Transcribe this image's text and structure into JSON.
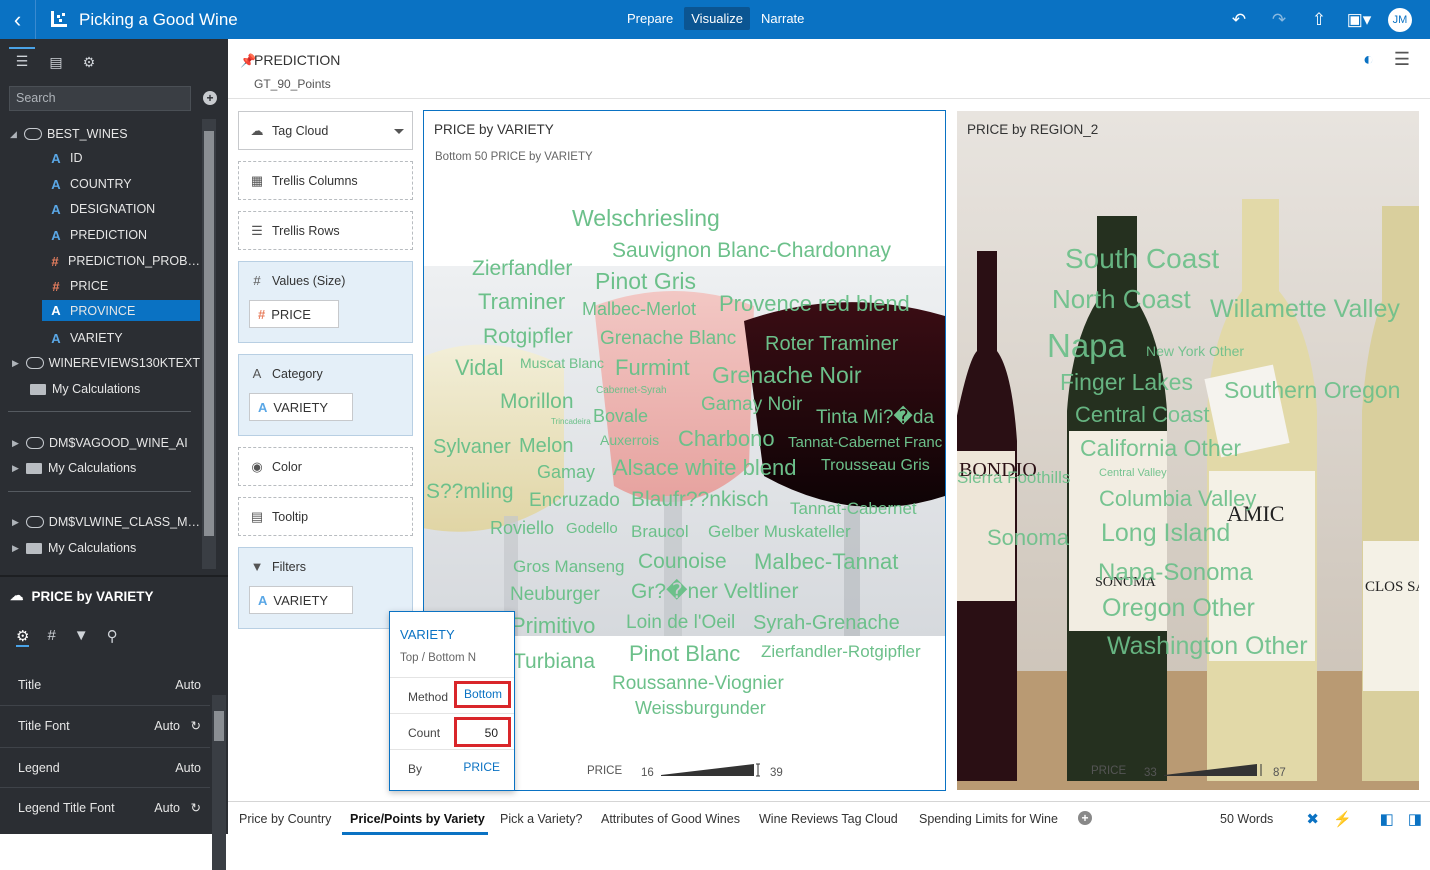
{
  "header": {
    "title": "Picking a Good Wine",
    "modes": [
      "Prepare",
      "Visualize",
      "Narrate"
    ],
    "active_mode": "Visualize",
    "avatar": "JM"
  },
  "left": {
    "search_placeholder": "Search",
    "tree": [
      {
        "label": "BEST_WINES",
        "type": "dataset",
        "expanded": true
      },
      {
        "label": "ID",
        "type": "attr"
      },
      {
        "label": "COUNTRY",
        "type": "attr"
      },
      {
        "label": "DESIGNATION",
        "type": "attr"
      },
      {
        "label": "PREDICTION",
        "type": "attr"
      },
      {
        "label": "PREDICTION_PROB…",
        "type": "measure"
      },
      {
        "label": "PRICE",
        "type": "measure"
      },
      {
        "label": "PROVINCE",
        "type": "attr",
        "selected": true
      },
      {
        "label": "VARIETY",
        "type": "attr"
      },
      {
        "label": "WINEREVIEWS130KTEXT",
        "type": "dataset"
      },
      {
        "label": "My Calculations",
        "type": "folder"
      },
      {
        "label": "DM$VAGOOD_WINE_AI",
        "type": "dataset"
      },
      {
        "label": "My Calculations",
        "type": "folder"
      },
      {
        "label": "DM$VLWINE_CLASS_M…",
        "type": "dataset"
      },
      {
        "label": "My Calculations",
        "type": "folder"
      }
    ]
  },
  "properties": {
    "title": "PRICE by VARIETY",
    "rows": [
      {
        "label": "Title",
        "value": "Auto"
      },
      {
        "label": "Title Font",
        "value": "Auto"
      },
      {
        "label": "Legend",
        "value": "Auto"
      },
      {
        "label": "Legend Title Font",
        "value": "Auto"
      }
    ]
  },
  "canvas": {
    "title": "PREDICTION",
    "subtitle": "GT_90_Points"
  },
  "grammar": {
    "viz_type": "Tag Cloud",
    "trellis_columns": "Trellis Columns",
    "trellis_rows": "Trellis Rows",
    "values_label": "Values (Size)",
    "values_pill": "PRICE",
    "category_label": "Category",
    "category_pill": "VARIETY",
    "color_label": "Color",
    "tooltip_label": "Tooltip",
    "filters_label": "Filters",
    "filters_pill": "VARIETY"
  },
  "popup": {
    "title": "VARIETY",
    "subtitle": "Top / Bottom N",
    "method_label": "Method",
    "method_value": "Bottom",
    "count_label": "Count",
    "count_value": "50",
    "by_label": "By",
    "by_value": "PRICE"
  },
  "viz1": {
    "title": "PRICE by VARIETY",
    "subtitle": "Bottom 50 PRICE by VARIETY",
    "legend_label": "PRICE",
    "legend_min": "16",
    "legend_max": "39",
    "words": [
      {
        "t": "Welschriesling",
        "s": 23
      },
      {
        "t": "Sauvignon Blanc-Chardonnay",
        "s": 21
      },
      {
        "t": "Zierfandler",
        "s": 21
      },
      {
        "t": "Pinot Gris",
        "s": 23
      },
      {
        "t": "Traminer",
        "s": 22
      },
      {
        "t": "Malbec-Merlot",
        "s": 18
      },
      {
        "t": "Provence red blend",
        "s": 22
      },
      {
        "t": "Rotgipfler",
        "s": 21
      },
      {
        "t": "Grenache Blanc",
        "s": 19
      },
      {
        "t": "Roter Traminer",
        "s": 20
      },
      {
        "t": "Vidal",
        "s": 22
      },
      {
        "t": "Muscat Blanc",
        "s": 14
      },
      {
        "t": "Furmint",
        "s": 22
      },
      {
        "t": "Grenache Noir",
        "s": 23
      },
      {
        "t": "Cabernet-Syrah",
        "s": 10
      },
      {
        "t": "Morillon",
        "s": 21
      },
      {
        "t": "Bovale",
        "s": 18
      },
      {
        "t": "Gamay Noir",
        "s": 19
      },
      {
        "t": "Tinta Mi?�da",
        "s": 19
      },
      {
        "t": "Trincadeira",
        "s": 8
      },
      {
        "t": "Auxerrois",
        "s": 14
      },
      {
        "t": "Charbono",
        "s": 22
      },
      {
        "t": "Tannat-Cabernet Franc",
        "s": 15
      },
      {
        "t": "Sylvaner",
        "s": 20
      },
      {
        "t": "Melon",
        "s": 20
      },
      {
        "t": "Gamay",
        "s": 18
      },
      {
        "t": "Alsace white blend",
        "s": 22
      },
      {
        "t": "Trousseau Gris",
        "s": 16
      },
      {
        "t": "S??mling",
        "s": 21
      },
      {
        "t": "Encruzado",
        "s": 19
      },
      {
        "t": "Blaufr??nkisch",
        "s": 21
      },
      {
        "t": "Tannat-Cabernet",
        "s": 17
      },
      {
        "t": "Roviello",
        "s": 18
      },
      {
        "t": "Godello",
        "s": 15
      },
      {
        "t": "Braucol",
        "s": 17
      },
      {
        "t": "Gelber Muskateller",
        "s": 17
      },
      {
        "t": "Counoise",
        "s": 21
      },
      {
        "t": "Malbec-Tannat",
        "s": 22
      },
      {
        "t": "Gros Manseng",
        "s": 17
      },
      {
        "t": "Neuburger",
        "s": 19
      },
      {
        "t": "Gr?�ner Veltliner",
        "s": 21
      },
      {
        "t": "Primitivo",
        "s": 22
      },
      {
        "t": "Loin de l'Oeil",
        "s": 19
      },
      {
        "t": "Syrah-Grenache",
        "s": 20
      },
      {
        "t": "Turbiana",
        "s": 21
      },
      {
        "t": "Pinot Blanc",
        "s": 22
      },
      {
        "t": "Zierfandler-Rotgipfler",
        "s": 17
      },
      {
        "t": "Roussanne-Viognier",
        "s": 19
      },
      {
        "t": "Weissburgunder",
        "s": 18
      }
    ]
  },
  "viz2": {
    "title": "PRICE by REGION_2",
    "legend_label": "PRICE",
    "legend_min": "33",
    "legend_max": "87",
    "words": [
      {
        "t": "South Coast",
        "s": 28
      },
      {
        "t": "North Coast",
        "s": 26
      },
      {
        "t": "Willamette Valley",
        "s": 25
      },
      {
        "t": "Napa",
        "s": 33
      },
      {
        "t": "New York Other",
        "s": 14
      },
      {
        "t": "Finger Lakes",
        "s": 23
      },
      {
        "t": "Southern Oregon",
        "s": 23
      },
      {
        "t": "Central Coast",
        "s": 22
      },
      {
        "t": "California Other",
        "s": 23
      },
      {
        "t": "Central Valley",
        "s": 11
      },
      {
        "t": "Sierra Foothills",
        "s": 17
      },
      {
        "t": "Columbia Valley",
        "s": 22
      },
      {
        "t": "Sonoma",
        "s": 22
      },
      {
        "t": "Long Island",
        "s": 25
      },
      {
        "t": "Napa-Sonoma",
        "s": 24
      },
      {
        "t": "Oregon Other",
        "s": 25
      },
      {
        "t": "Washington Other",
        "s": 25
      }
    ]
  },
  "tabs": {
    "items": [
      "Price by Country",
      "Price/Points by Variety",
      "Pick a Variety?",
      "Attributes of Good Wines",
      "Wine Reviews Tag Cloud",
      "Spending Limits for Wine"
    ],
    "active": "Price/Points by Variety",
    "word_count": "50 Words"
  },
  "colors": {
    "accent": "#0a72c3",
    "word": "#6cc08a",
    "highlight": "#d9262a"
  }
}
